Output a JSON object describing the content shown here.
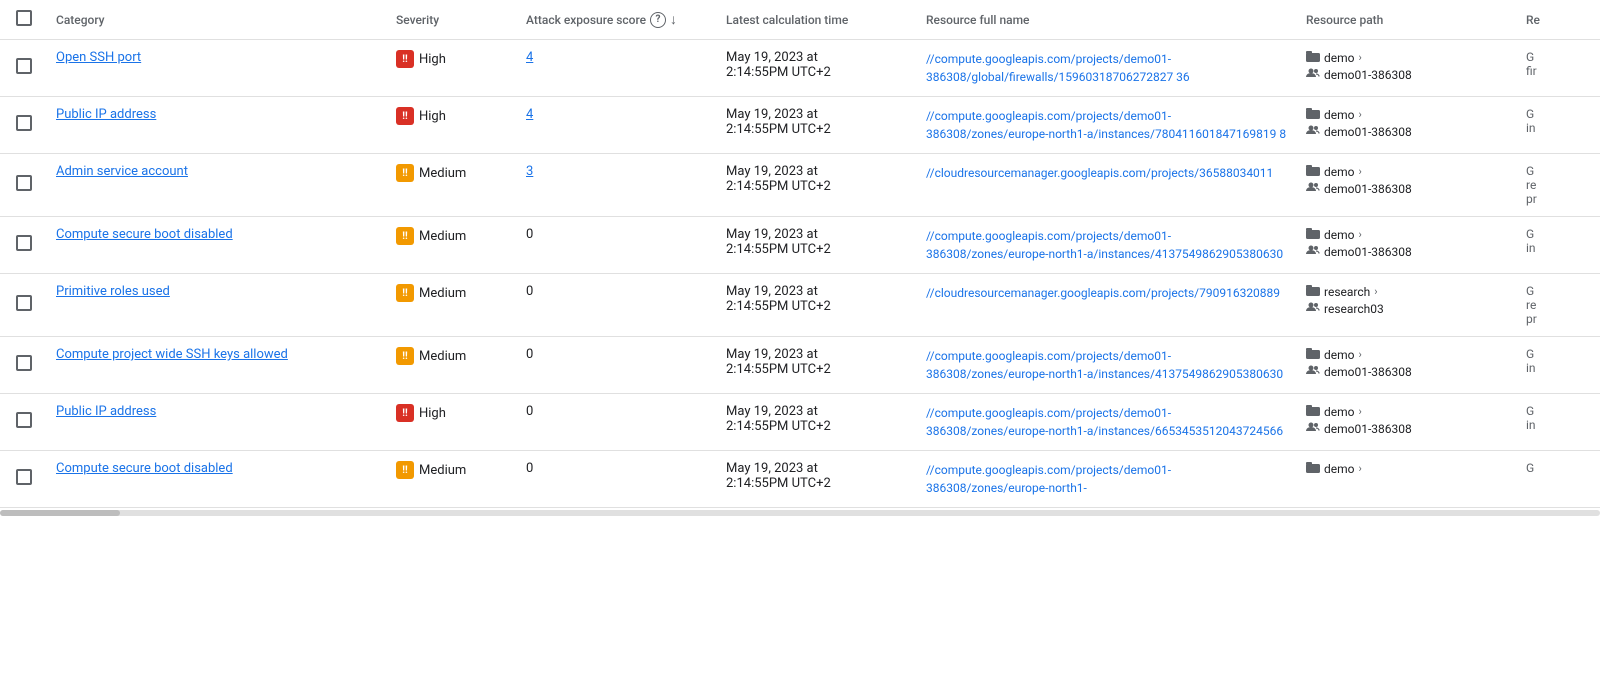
{
  "table": {
    "headers": {
      "check": "",
      "category": "Category",
      "severity": "Severity",
      "attack": "Attack exposure score",
      "time": "Latest calculation time",
      "fullname": "Resource full name",
      "path": "Resource path",
      "re": "Re"
    },
    "rows": [
      {
        "id": "row-1",
        "category": "Open SSH port",
        "severity": "High",
        "severity_level": "high",
        "attack_score": "4",
        "time_line1": "May 19, 2023 at",
        "time_line2": "2:14:55PM UTC+2",
        "resource_full_name": "//compute.googleapis.com/projects/demo01-386308/global/firewalls/15960318706272827 36",
        "resource_path_folder": "demo",
        "resource_path_people": "demo01-386308",
        "re_line1": "G",
        "re_line2": "fir"
      },
      {
        "id": "row-2",
        "category": "Public IP address",
        "severity": "High",
        "severity_level": "high",
        "attack_score": "4",
        "time_line1": "May 19, 2023 at",
        "time_line2": "2:14:55PM UTC+2",
        "resource_full_name": "//compute.googleapis.com/projects/demo01-386308/zones/europe-north1-a/instances/780411601847169819 8",
        "resource_path_folder": "demo",
        "resource_path_people": "demo01-386308",
        "re_line1": "G",
        "re_line2": "in"
      },
      {
        "id": "row-3",
        "category": "Admin service account",
        "severity": "Medium",
        "severity_level": "medium",
        "attack_score": "3",
        "time_line1": "May 19, 2023 at",
        "time_line2": "2:14:55PM UTC+2",
        "resource_full_name": "//cloudresourcemanager.googleapis.com/projects/36588034011",
        "resource_path_folder": "demo",
        "resource_path_people": "demo01-386308",
        "re_line1": "G",
        "re_line2": "re",
        "re_line3": "pr"
      },
      {
        "id": "row-4",
        "category": "Compute secure boot disabled",
        "severity": "Medium",
        "severity_level": "medium",
        "attack_score": "0",
        "time_line1": "May 19, 2023 at",
        "time_line2": "2:14:55PM UTC+2",
        "resource_full_name": "//compute.googleapis.com/projects/demo01-386308/zones/europe-north1-a/instances/4137549862905380630",
        "resource_path_folder": "demo",
        "resource_path_people": "demo01-386308",
        "re_line1": "G",
        "re_line2": "in"
      },
      {
        "id": "row-5",
        "category": "Primitive roles used",
        "severity": "Medium",
        "severity_level": "medium",
        "attack_score": "0",
        "time_line1": "May 19, 2023 at",
        "time_line2": "2:14:55PM UTC+2",
        "resource_full_name": "//cloudresourcemanager.googleapis.com/projects/790916320889",
        "resource_path_folder": "research",
        "resource_path_people": "research03",
        "re_line1": "G",
        "re_line2": "re",
        "re_line3": "pr"
      },
      {
        "id": "row-6",
        "category": "Compute project wide SSH keys allowed",
        "severity": "Medium",
        "severity_level": "medium",
        "attack_score": "0",
        "time_line1": "May 19, 2023 at",
        "time_line2": "2:14:55PM UTC+2",
        "resource_full_name": "//compute.googleapis.com/projects/demo01-386308/zones/europe-north1-a/instances/4137549862905380630",
        "resource_path_folder": "demo",
        "resource_path_people": "demo01-386308",
        "re_line1": "G",
        "re_line2": "in"
      },
      {
        "id": "row-7",
        "category": "Public IP address",
        "severity": "High",
        "severity_level": "high",
        "attack_score": "0",
        "time_line1": "May 19, 2023 at",
        "time_line2": "2:14:55PM UTC+2",
        "resource_full_name": "//compute.googleapis.com/projects/demo01-386308/zones/europe-north1-a/instances/6653453512043724566",
        "resource_path_folder": "demo",
        "resource_path_people": "demo01-386308",
        "re_line1": "G",
        "re_line2": "in"
      },
      {
        "id": "row-8",
        "category": "Compute secure boot disabled",
        "severity": "Medium",
        "severity_level": "medium",
        "attack_score": "0",
        "time_line1": "May 19, 2023 at",
        "time_line2": "2:14:55PM UTC+2",
        "resource_full_name": "//compute.googleapis.com/projects/demo01-386308/zones/europe-north1-",
        "resource_path_folder": "demo",
        "resource_path_people": "",
        "re_line1": "G",
        "re_line2": ""
      }
    ]
  },
  "colors": {
    "high": "#d93025",
    "medium": "#f29900",
    "link_blue": "#1a73e8"
  }
}
